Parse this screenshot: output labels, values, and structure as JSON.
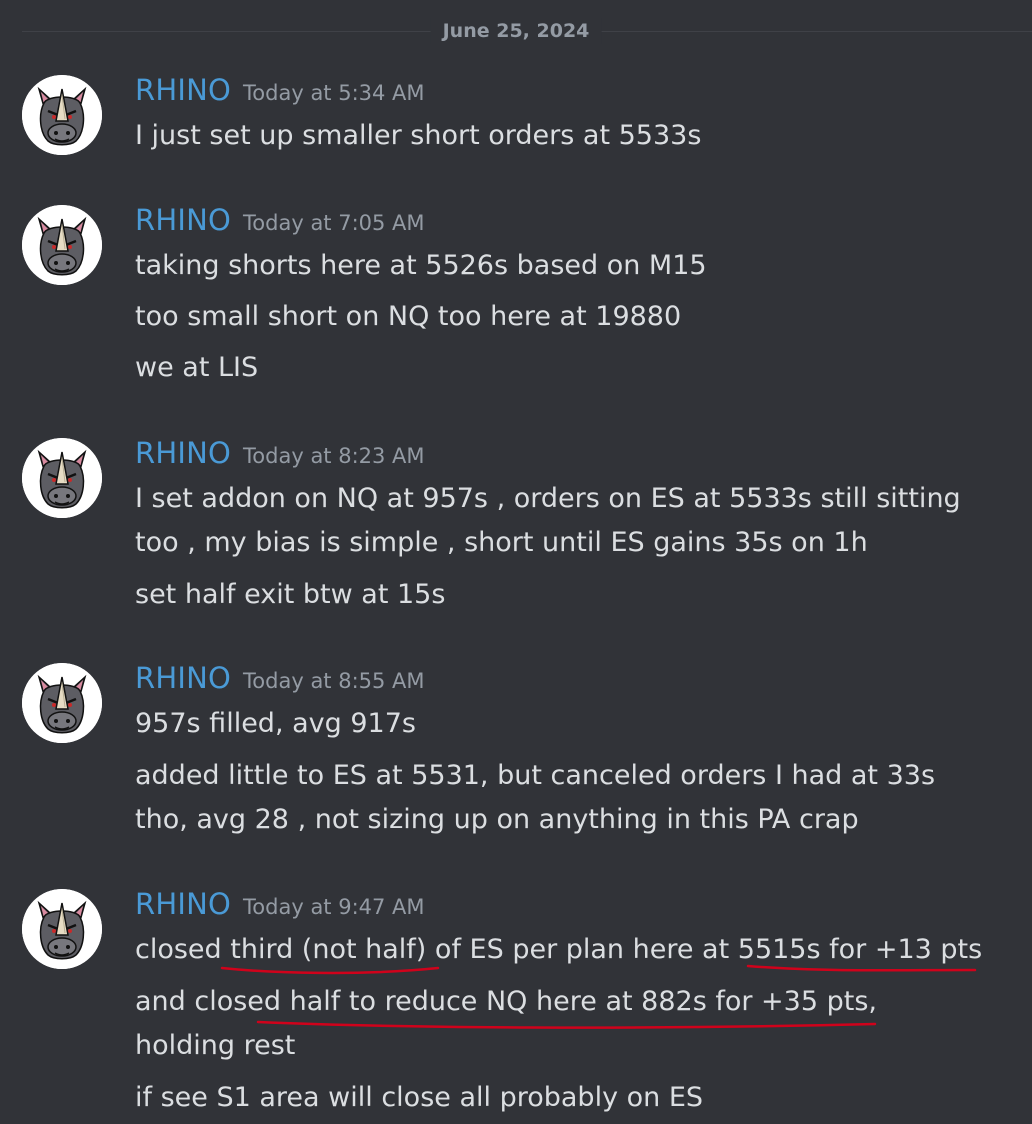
{
  "date_divider": "June 25, 2024",
  "colors": {
    "background": "#313338",
    "author": "#4a9ad6",
    "text": "#dbdee1",
    "timestamp": "#949ba4",
    "underline": "#d0021b"
  },
  "avatar_icon": "rhino-head-icon",
  "messages": [
    {
      "author": "RHINO",
      "timestamp": "Today at 5:34 AM",
      "lines": [
        "I just set up smaller short orders at 5533s"
      ]
    },
    {
      "author": "RHINO",
      "timestamp": "Today at 7:05 AM",
      "lines": [
        "taking shorts here at 5526s based on M15",
        "too small short on NQ too here at 19880",
        "we at LIS"
      ]
    },
    {
      "author": "RHINO",
      "timestamp": "Today at 8:23 AM",
      "lines": [
        "I set addon on NQ at 957s , orders on ES at 5533s still sitting too , my bias is simple , short until ES gains 35s on 1h",
        "set half exit btw at 15s"
      ]
    },
    {
      "author": "RHINO",
      "timestamp": "Today at 8:55 AM",
      "lines": [
        "957s filled, avg 917s",
        "added little to ES at 5531, but canceled orders I had at 33s tho, avg 28 , not sizing up on anything in this PA crap"
      ]
    },
    {
      "author": "RHINO",
      "timestamp": "Today at 9:47 AM",
      "lines": [
        "closed third (not half) of ES per plan here at 5515s for +13 pts",
        "and closed half to reduce NQ here at 882s for +35 pts, holding rest",
        "if see S1 area will close all probably on ES"
      ]
    }
  ]
}
